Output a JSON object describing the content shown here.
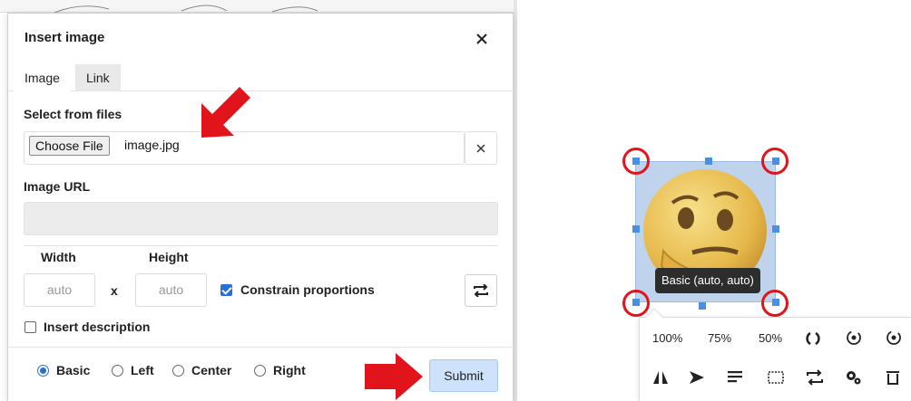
{
  "dialog": {
    "title": "Insert image",
    "tabs": [
      {
        "label": "Image",
        "active": true
      },
      {
        "label": "Link",
        "active": false
      }
    ],
    "select_from_files": {
      "label": "Select from files",
      "choose_button": "Choose File",
      "file_name": "image.jpg"
    },
    "image_url": {
      "label": "Image URL",
      "value": ""
    },
    "dimensions": {
      "width_label": "Width",
      "height_label": "Height",
      "width_value": "auto",
      "height_value": "auto",
      "separator": "x",
      "constrain_label": "Constrain proportions",
      "constrain_checked": true
    },
    "insert_description": {
      "label": "Insert description",
      "checked": false
    },
    "alignment": {
      "options": [
        "Basic",
        "Left",
        "Center",
        "Right"
      ],
      "selected": "Basic"
    },
    "submit_label": "Submit"
  },
  "image_editor": {
    "tooltip": "Basic (auto, auto)",
    "size_options": [
      "100%",
      "75%",
      "50%"
    ],
    "row1_icons": [
      "rotate-icon",
      "rotate-left-icon",
      "rotate-right-icon"
    ],
    "row2_icons": [
      "flip-horizontal-icon",
      "flip-vertical-icon",
      "align-icon",
      "crop-icon",
      "replace-icon",
      "settings-icon",
      "delete-icon"
    ]
  },
  "colors": {
    "accent": "#2b6fd6",
    "submit_bg": "#cfe2fb",
    "highlight_red": "#e0141a",
    "handle_blue": "#4a90e2"
  }
}
